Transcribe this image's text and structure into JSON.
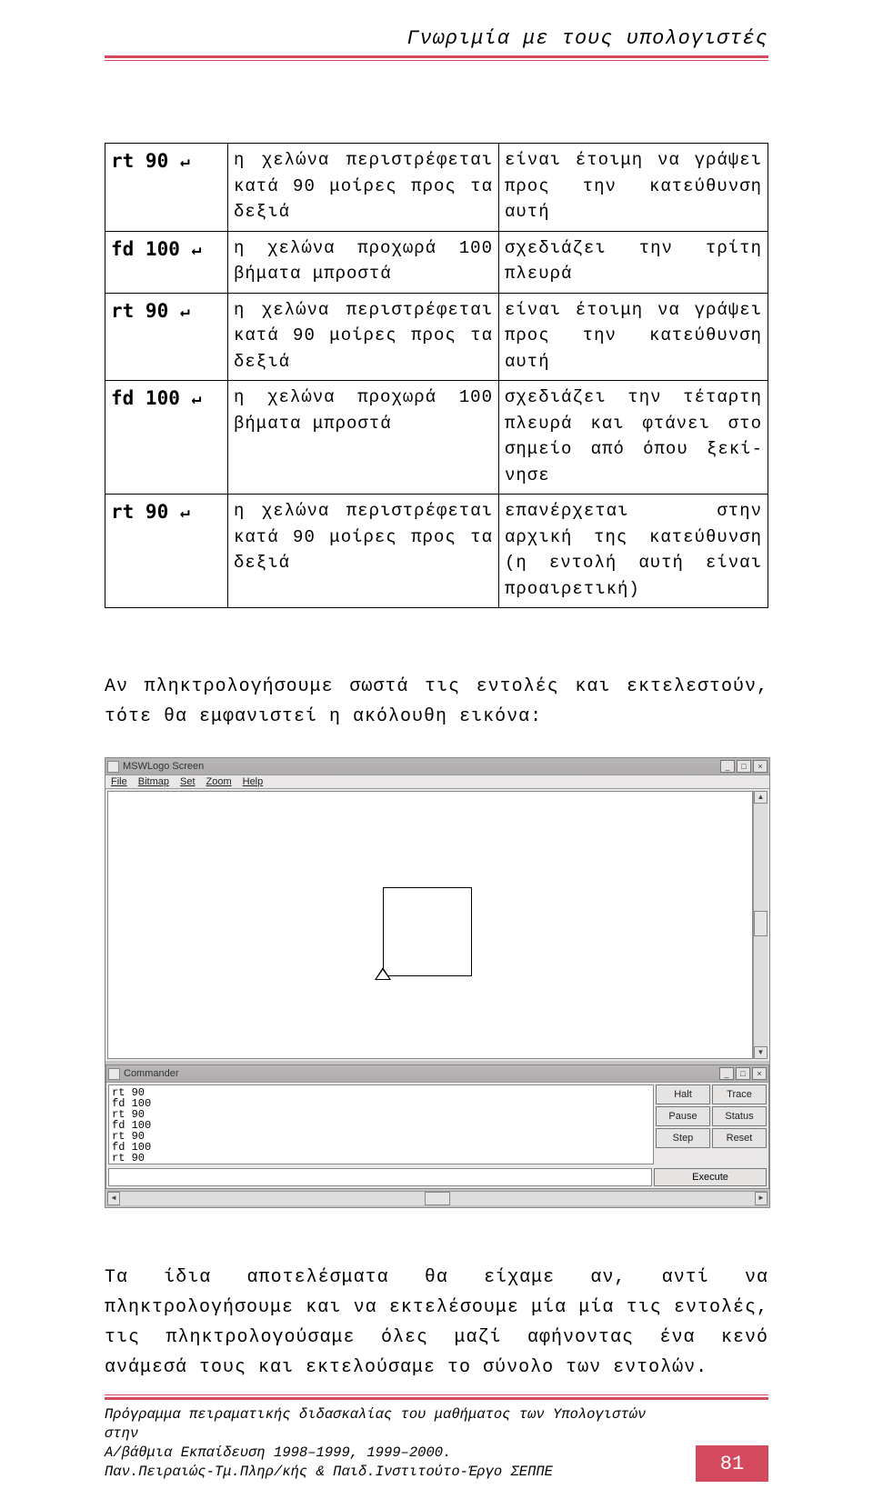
{
  "header": {
    "title": "Γνωριμία με τους υπολογιστές"
  },
  "table": {
    "rows": [
      {
        "cmd": "rt 90",
        "desc": "η χελώνα περιστρέφεται κατά 90 μοίρες προς τα δεξιά",
        "expl": "είναι έτοιμη να γράψει προς την κατεύθυνση αυτή"
      },
      {
        "cmd": "fd 100",
        "desc": "η χελώνα προχωρά 100 βήματα μπροστά",
        "expl": "σχεδιάζει την τρίτη πλευρά"
      },
      {
        "cmd": "rt 90",
        "desc": "η χελώνα περιστρέφεται κατά 90 μοίρες προς τα δεξιά",
        "expl": "είναι έτοιμη να γράψει προς την κατεύθυνση αυτή"
      },
      {
        "cmd": "fd 100",
        "desc": "η χελώνα προχωρά 100 βήματα μπροστά",
        "expl": "σχεδιάζει την τέταρτη πλευρά και φτάνει στο σημείο από όπου ξεκί­νησε"
      },
      {
        "cmd": "rt 90",
        "desc": "η χελώνα περιστρέφεται κατά 90 μοίρες προς τα δεξιά",
        "expl": "επανέρχεται στην αρχική της κα­τεύθυνση (η εντολή αυτή είναι προαιρετική)"
      }
    ]
  },
  "para1": "Αν πληκτρολογήσουμε σωστά τις εντολές και εκτελεστούν, τό­τε θα εμφανιστεί η ακόλουθη εικόνα:",
  "mswlogo": {
    "title": "MSWLogo Screen",
    "menu": {
      "file": "File",
      "bitmap": "Bitmap",
      "set": "Set",
      "zoom": "Zoom",
      "help": "Help"
    },
    "commander": {
      "title": "Commander",
      "history": "rt 90\nfd 100\nrt 90\nfd 100\nrt 90\nfd 100\nrt 90",
      "buttons": {
        "halt": "Halt",
        "trace": "Trace",
        "pause": "Pause",
        "status": "Status",
        "step": "Step",
        "reset": "Reset"
      },
      "execute": "Execute"
    },
    "window_controls": {
      "min": "_",
      "max": "□",
      "close": "×"
    }
  },
  "para2": "Τα ίδια αποτελέσματα θα είχαμε αν, αντί να πληκτρολογήσου­με  και να εκτελέσουμε μία μία τις εντολές, τις πληκτρολο­γούσαμε όλες μαζί αφήνοντας ένα κενό ανάμεσά τους και ε­κτελούσαμε το σύνολο των εντολών.",
  "footer": {
    "line1": "Πρόγραμμα πειραματικής διδασκαλίας του μαθήματος των Υπολογιστών στην",
    "line2": "Α/βάθμια Εκπαίδευση 1998–1999, 1999–2000.",
    "line3": "Παν.Πειραιώς-Τμ.Πληρ/κής & Παιδ.Ινστιτούτο-Έργο ΣΕΠΠΕ",
    "page": "81"
  },
  "glyph": {
    "return": "↵"
  }
}
